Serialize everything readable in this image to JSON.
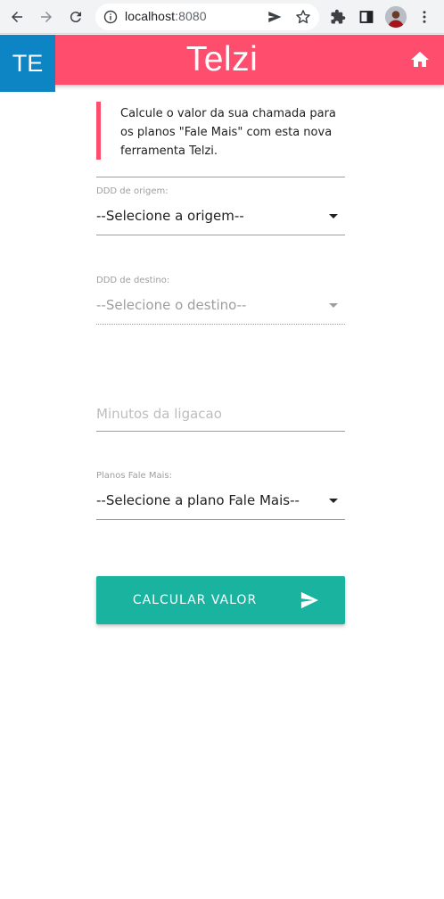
{
  "browser": {
    "url_host": "localhost",
    "url_port": ":8080",
    "icons": [
      "back-icon",
      "forward-icon",
      "reload-icon",
      "info-icon",
      "send-tab-icon",
      "star-icon",
      "extensions-icon",
      "side-panel-icon",
      "profile-avatar",
      "more-icon"
    ]
  },
  "header": {
    "logo_text": "TE",
    "title": "Telzi",
    "home_icon": "home-icon",
    "colors": {
      "bar": "#ff4d6d",
      "logo": "#0d84c4"
    }
  },
  "intro": {
    "text": "Calcule o valor da sua chamada para os planos \"Fale Mais\" com esta nova ferramenta Telzi."
  },
  "form": {
    "origin": {
      "label": "DDD de origem:",
      "selected": "--Selecione a origem--"
    },
    "destination": {
      "label": "DDD de destino:",
      "selected": "--Selecione o destino--",
      "disabled": true
    },
    "minutes": {
      "placeholder": "Minutos da ligacao",
      "value": ""
    },
    "plan": {
      "label": "Planos Fale Mais:",
      "selected": "--Selecione a plano Fale Mais--"
    },
    "submit": {
      "label": "CALCULAR VALOR",
      "icon": "send-icon",
      "color": "#19b3a0"
    }
  }
}
